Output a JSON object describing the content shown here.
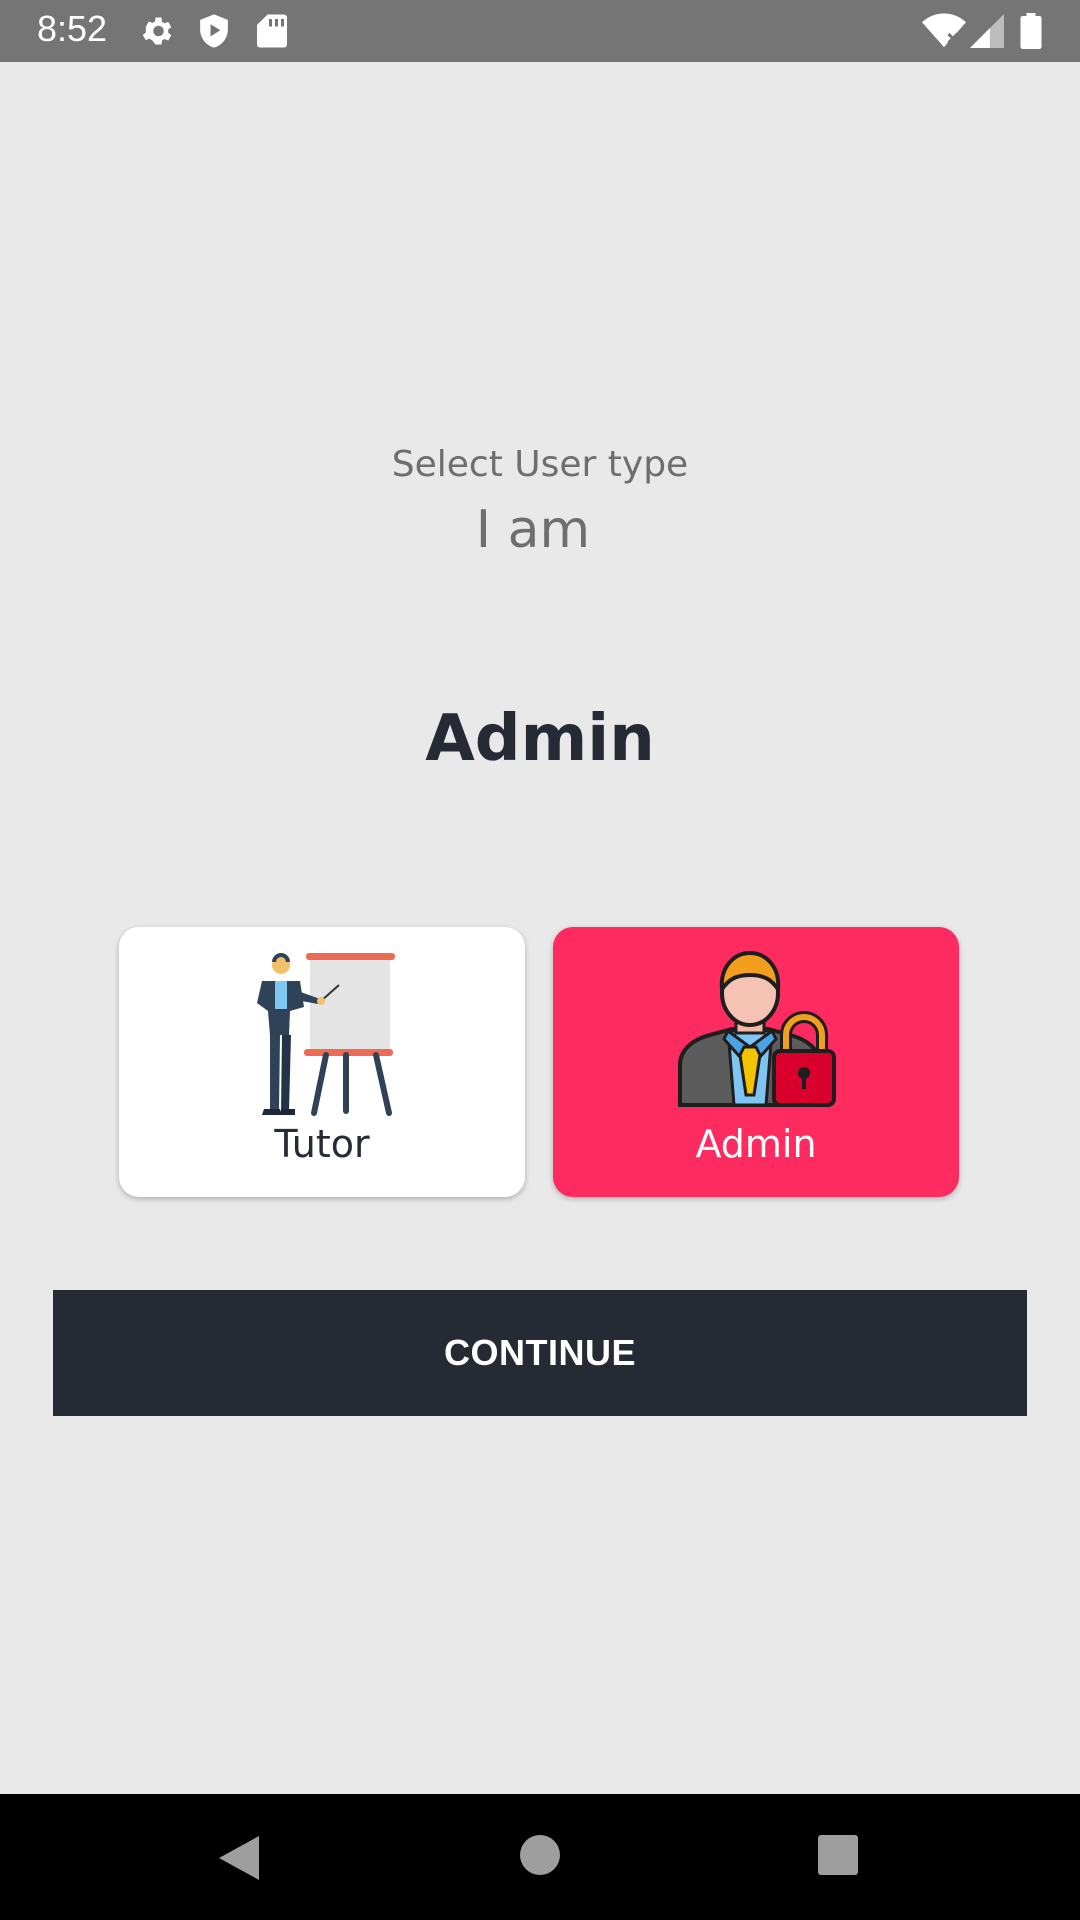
{
  "status_bar": {
    "time": "8:52",
    "left_icons": [
      "settings-icon",
      "shield-play-icon",
      "sd-card-icon"
    ],
    "right_icons": [
      "wifi-icon",
      "signal-icon",
      "battery-icon"
    ]
  },
  "screen": {
    "subtitle": "Select User type",
    "heading": "I am",
    "selected_type": "Admin"
  },
  "user_types": [
    {
      "label": "Tutor",
      "icon": "tutor-presentation-icon",
      "selected": false
    },
    {
      "label": "Admin",
      "icon": "admin-lock-icon",
      "selected": true
    }
  ],
  "continue_label": "CONTINUE",
  "colors": {
    "accent": "#fe2b60",
    "dark": "#252a35",
    "background": "#e9e9ea"
  },
  "nav_bar": [
    "back-icon",
    "home-icon",
    "recents-icon"
  ]
}
